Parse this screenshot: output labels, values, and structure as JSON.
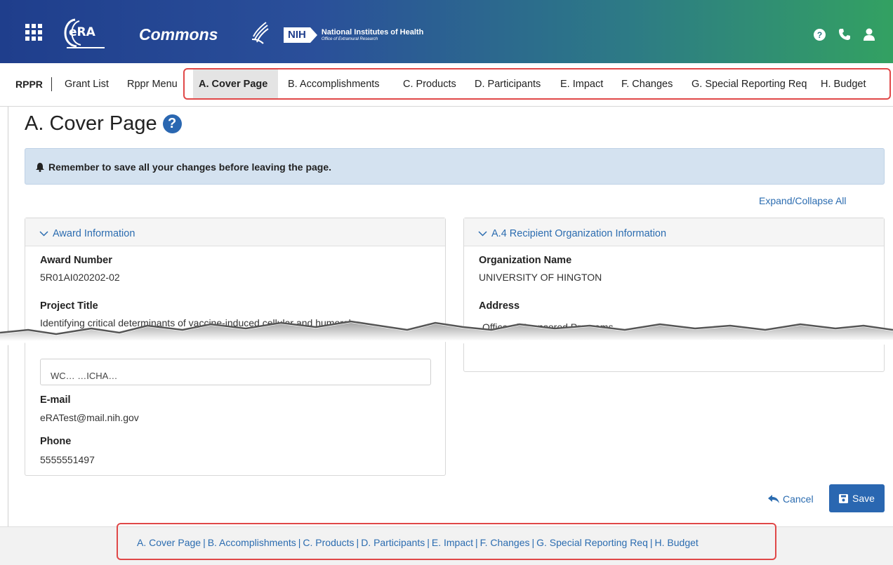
{
  "header": {
    "logo_text": "eRA",
    "app_name": "Commons",
    "nih_tag": "NIH",
    "nih_name": "National Institutes of Health",
    "nih_sub": "Office of Extramural Research",
    "icons": [
      "grid-menu-icon",
      "help-icon",
      "phone-icon",
      "user-icon"
    ]
  },
  "nav": {
    "section": "RPPR",
    "items": [
      {
        "label": "Grant List"
      },
      {
        "label": "Rppr Menu"
      },
      {
        "label": "A. Cover Page",
        "active": true
      },
      {
        "label": "B. Accomplishments"
      },
      {
        "label": "C. Products"
      },
      {
        "label": "D. Participants"
      },
      {
        "label": "E. Impact"
      },
      {
        "label": "F. Changes"
      },
      {
        "label": "G. Special Reporting Req"
      },
      {
        "label": "H. Budget"
      }
    ]
  },
  "page": {
    "title": "A. Cover Page",
    "alert": "Remember to save all your changes before leaving the page.",
    "expand_collapse": "Expand/Collapse All"
  },
  "award": {
    "heading": "Award Information",
    "award_number_label": "Award Number",
    "award_number": "5R01AI020202-02",
    "project_title_label": "Project Title",
    "project_title": "Identifying critical determinants of vaccine-induced cellular and humoral",
    "partial_field": "WC…  …ICHA…",
    "email_label": "E-mail",
    "email": "eRATest@mail.nih.gov",
    "phone_label": "Phone",
    "phone": "5555551497"
  },
  "recipient": {
    "heading": "A.4 Recipient Organization Information",
    "org_name_label": "Organization Name",
    "org_name": "UNIVERSITY OF HINGTON",
    "address_label": "Address",
    "address_line": "Office of S…nsored Programs"
  },
  "actions": {
    "cancel": "Cancel",
    "save": "Save"
  },
  "footer_links": [
    "A. Cover Page",
    "B. Accomplishments",
    "C. Products",
    "D. Participants",
    "E. Impact",
    "F. Changes",
    "G. Special Reporting Req",
    "H. Budget"
  ],
  "colors": {
    "brand_blue": "#1f3e8c",
    "brand_green": "#33a162",
    "link": "#2b6cb0",
    "primary_button": "#2a67b1",
    "highlight_outline": "#e04848",
    "alert_bg": "#d4e2f0"
  }
}
